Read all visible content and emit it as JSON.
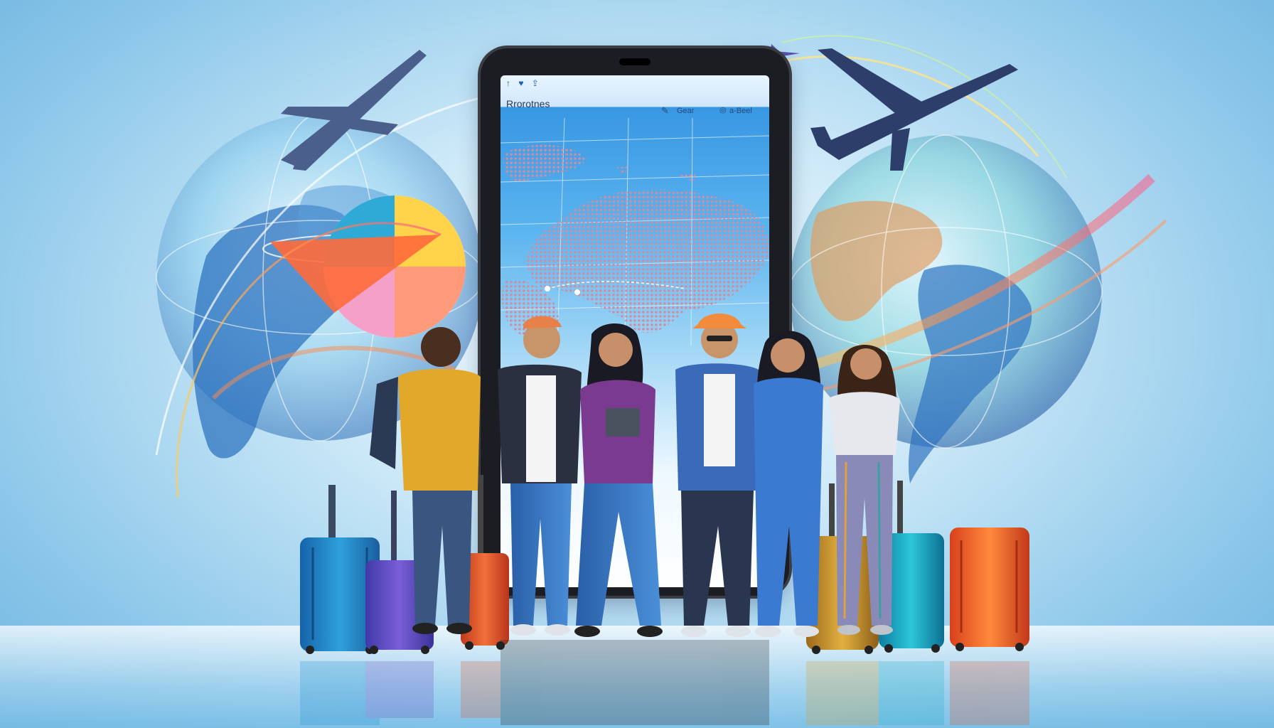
{
  "tablet_app": {
    "title": "Rrorotnes",
    "top_icons": "↑ ♥ ⇪",
    "header_label_1": "Gear",
    "header_label_2": "a-Beel"
  },
  "colors": {
    "sky_light": "#f4fbff",
    "sky_dark": "#6fb4e0",
    "tablet_frame": "#1b1d22",
    "suitcase_blue": "#1f8fd0",
    "suitcase_purple": "#6a4fc4",
    "suitcase_orange": "#e0532a",
    "suitcase_gold": "#d6a12b",
    "suitcase_teal": "#1fb0c8",
    "accent_orange": "#f28b3c"
  },
  "icons": [
    "airplane-icon",
    "globe-icon",
    "suitcase-icon",
    "map-icon"
  ]
}
